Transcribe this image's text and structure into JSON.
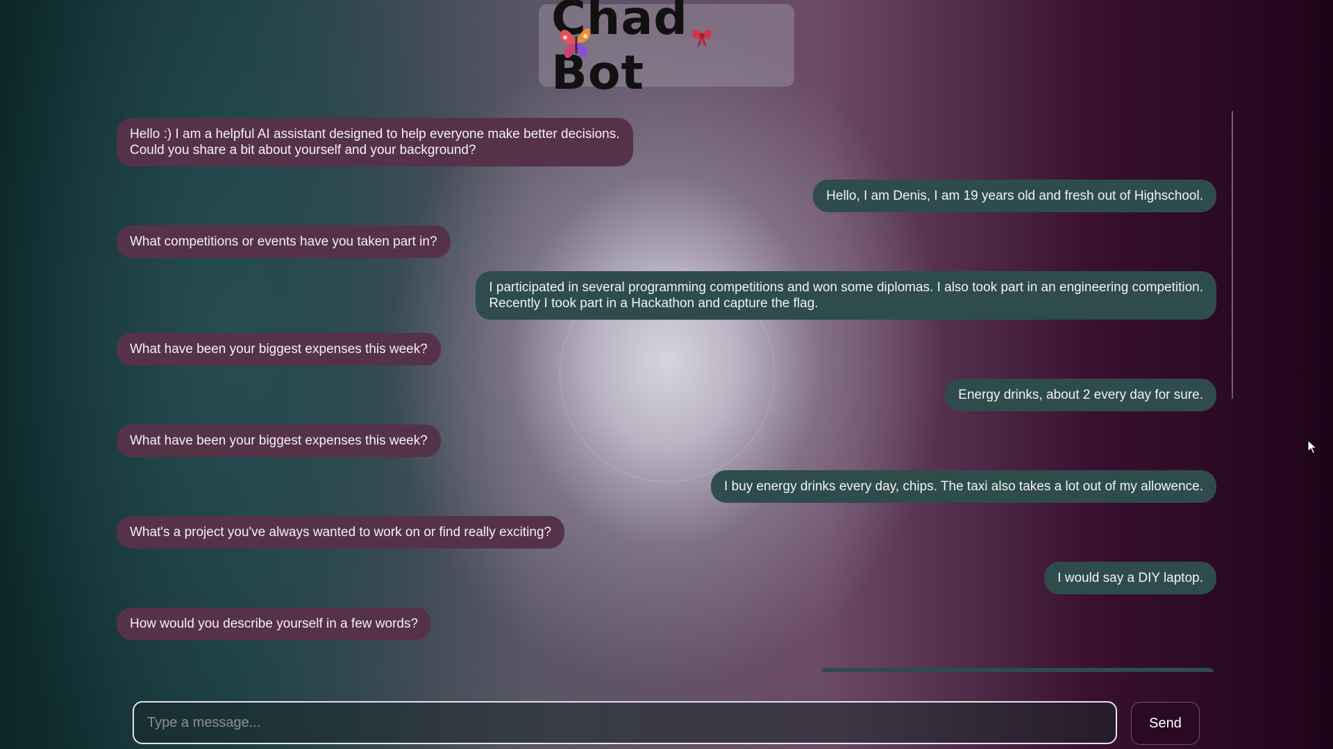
{
  "app": {
    "title": "Chad Bot"
  },
  "messages": [
    {
      "sender": "bot",
      "text": "Hello :) I am a helpful AI assistant designed to help everyone make better decisions.\nCould you share a bit about yourself and your background?"
    },
    {
      "sender": "user",
      "text": "Hello, I am Denis, I am 19 years old and fresh out of Highschool."
    },
    {
      "sender": "bot",
      "text": "What competitions or events have you taken part in?"
    },
    {
      "sender": "user",
      "text": "I participated in several programming competitions and won some diplomas. I also took part in an engineering competition.\nRecently I took part in a Hackathon and capture the flag."
    },
    {
      "sender": "bot",
      "text": "What have been your biggest expenses this week?"
    },
    {
      "sender": "user",
      "text": "Energy drinks, about 2 every day for sure."
    },
    {
      "sender": "bot",
      "text": "What have been your biggest expenses this week?"
    },
    {
      "sender": "user",
      "text": "I buy energy drinks every day, chips. The taxi also takes a lot out of my allowence."
    },
    {
      "sender": "bot",
      "text": "What's a project you've always wanted to work on or find really exciting?"
    },
    {
      "sender": "user",
      "text": "I would say a DIY laptop."
    },
    {
      "sender": "bot",
      "text": "How would you describe yourself in a few words?"
    }
  ],
  "composer": {
    "placeholder": "Type a message...",
    "value": "",
    "send_label": "Send"
  },
  "colors": {
    "bot_bubble": "#563249",
    "user_bubble": "#2f4c4c"
  },
  "icons": {
    "logo_left": "butterfly-icon",
    "logo_right": "bow-icon",
    "pointer": "mouse-cursor-icon"
  }
}
